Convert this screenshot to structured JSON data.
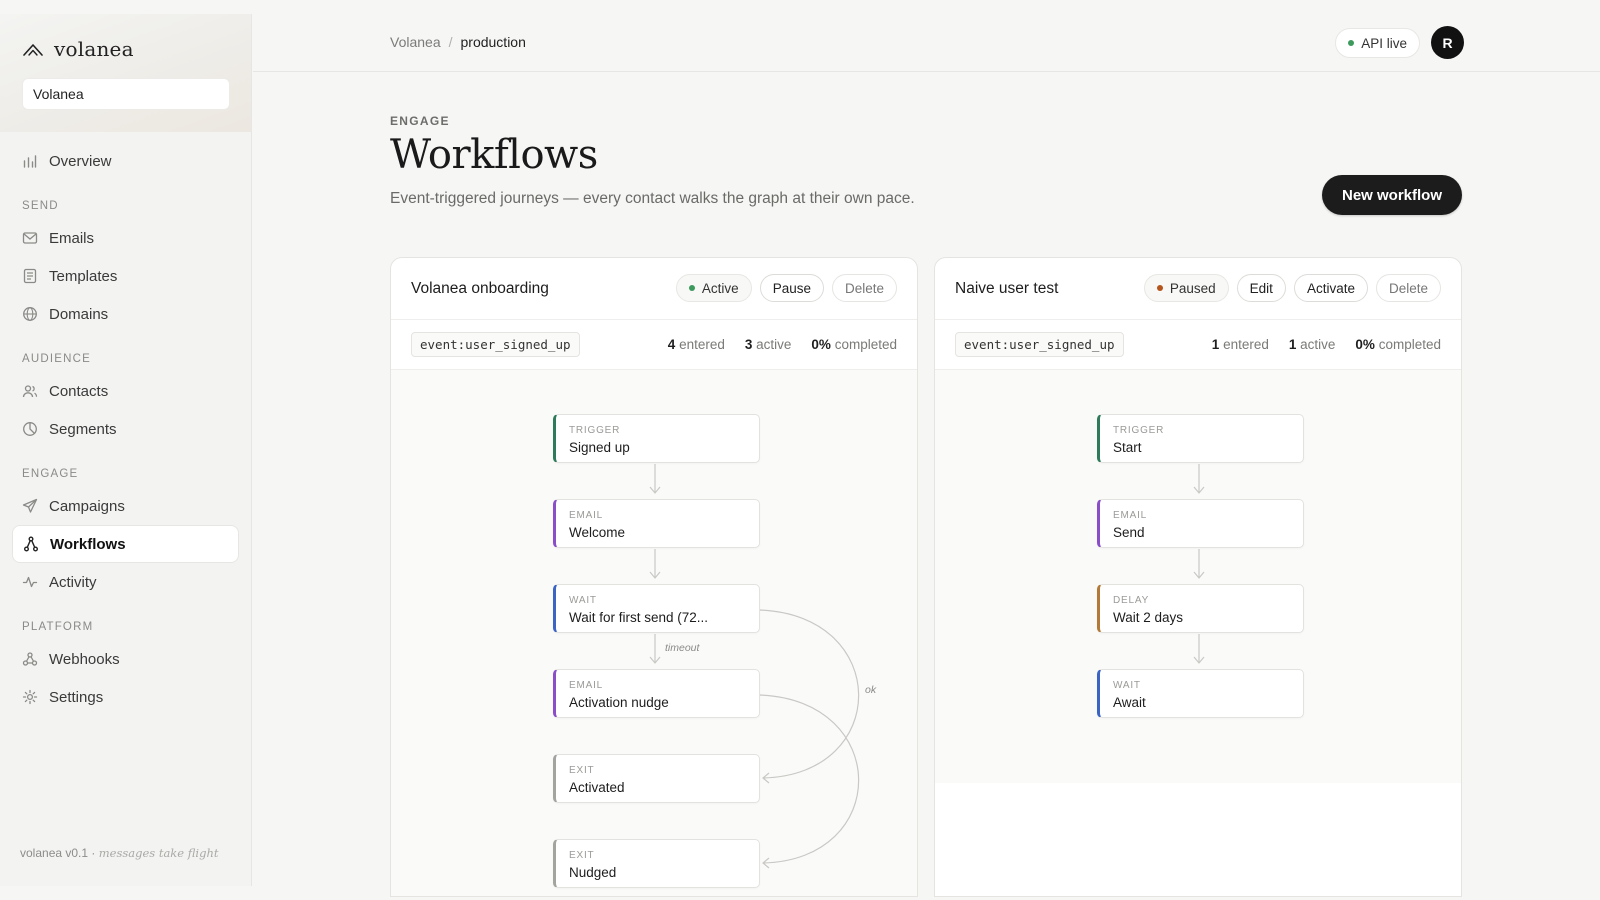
{
  "sidebar": {
    "brand": "volanea",
    "workspace": "Volanea",
    "nav": {
      "overview": "Overview",
      "send_section": "SEND",
      "emails": "Emails",
      "templates": "Templates",
      "domains": "Domains",
      "audience_section": "AUDIENCE",
      "contacts": "Contacts",
      "segments": "Segments",
      "engage_section": "ENGAGE",
      "campaigns": "Campaigns",
      "workflows": "Workflows",
      "activity": "Activity",
      "platform_section": "PLATFORM",
      "webhooks": "Webhooks",
      "settings": "Settings"
    },
    "footer": {
      "version": "volanea v0.1 ·",
      "tagline": "messages take flight"
    }
  },
  "topbar": {
    "breadcrumb_root": "Volanea",
    "breadcrumb_sep": "/",
    "breadcrumb_current": "production",
    "api_status": "API live",
    "avatar_initial": "R"
  },
  "header": {
    "eyebrow": "ENGAGE",
    "title": "Workflows",
    "subtitle": "Event-triggered journeys — every contact walks the graph at their own pace.",
    "new_button": "New workflow"
  },
  "colors": {
    "active": "#3d9a5d",
    "paused": "#b5541c",
    "trigger": "#2f7a5c",
    "email": "#8a4fc8",
    "wait": "#3b64c4",
    "delay": "#b27a36",
    "exit": "#a3a3a0"
  },
  "workflows": [
    {
      "name": "Volanea onboarding",
      "status": "Active",
      "actions": [
        "Pause",
        "Delete"
      ],
      "event": "event:user_signed_up",
      "entered": "4",
      "entered_label": "entered",
      "active": "3",
      "active_label": "active",
      "completed": "0%",
      "completed_label": "completed",
      "nodes": [
        {
          "kind": "TRIGGER",
          "label": "Signed up"
        },
        {
          "kind": "EMAIL",
          "label": "Welcome"
        },
        {
          "kind": "WAIT",
          "label": "Wait for first send (72..."
        },
        {
          "kind": "EMAIL",
          "label": "Activation nudge"
        },
        {
          "kind": "EXIT",
          "label": "Activated"
        },
        {
          "kind": "EXIT",
          "label": "Nudged"
        }
      ],
      "edge_labels": {
        "timeout": "timeout",
        "ok": "ok"
      }
    },
    {
      "name": "Naive user test",
      "status": "Paused",
      "actions": [
        "Edit",
        "Activate",
        "Delete"
      ],
      "event": "event:user_signed_up",
      "entered": "1",
      "entered_label": "entered",
      "active": "1",
      "active_label": "active",
      "completed": "0%",
      "completed_label": "completed",
      "nodes": [
        {
          "kind": "TRIGGER",
          "label": "Start"
        },
        {
          "kind": "EMAIL",
          "label": "Send"
        },
        {
          "kind": "DELAY",
          "label": "Wait 2 days"
        },
        {
          "kind": "WAIT",
          "label": "Await"
        }
      ]
    }
  ]
}
